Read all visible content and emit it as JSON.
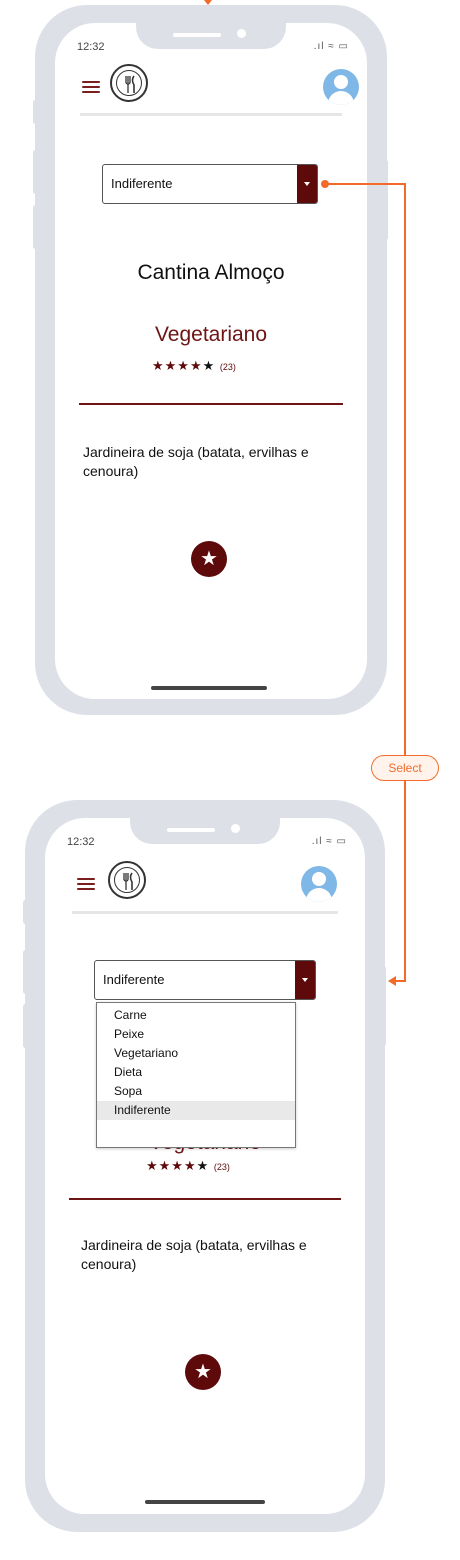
{
  "flow": {
    "transition_label": "Select",
    "accent_color": "#f26b2a"
  },
  "screen1": {
    "status_time": "12:32",
    "status_icons": ".ıl ≈ ▭",
    "select_value": "Indiferente",
    "place_title": "Cantina Almoço",
    "category_title": "Vegetariano",
    "rating_stars": "★★★★",
    "rating_last_star": "★",
    "rating_count": "(23)",
    "meal_description": "Jardineira de soja (batata, ervilhas e cenoura)",
    "favorite_glyph": "★"
  },
  "screen2": {
    "status_time": "12:32",
    "status_icons": ".ıl ≈ ▭",
    "select_value": "Indiferente",
    "options": [
      "Carne",
      "Peixe",
      "Vegetariano",
      "Dieta",
      "Sopa",
      "Indiferente"
    ],
    "selected_option": "Indiferente",
    "category_title": "Vegetariano",
    "rating_stars": "★★★★",
    "rating_last_star": "★",
    "rating_count": "(23)",
    "meal_description": "Jardineira de soja (batata, ervilhas e cenoura)",
    "favorite_glyph": "★"
  },
  "colors": {
    "brand": "#5e0a0a",
    "brand_text": "#6e1414",
    "avatar": "#7fb7e6"
  }
}
